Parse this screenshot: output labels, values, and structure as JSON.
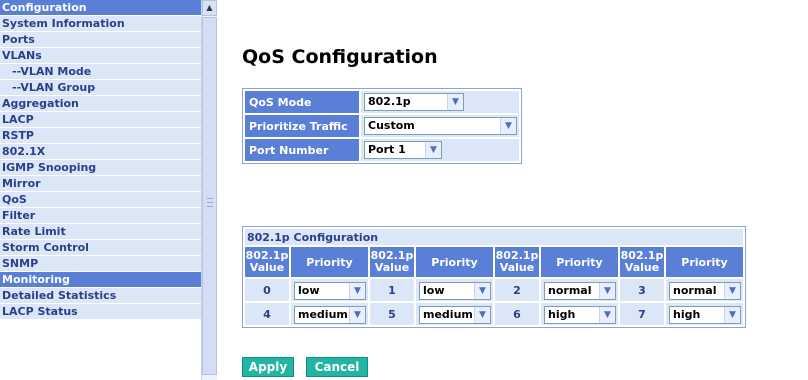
{
  "nav": {
    "items": [
      {
        "label": "Configuration",
        "kind": "header"
      },
      {
        "label": "System Information",
        "kind": "item"
      },
      {
        "label": "Ports",
        "kind": "item"
      },
      {
        "label": "VLANs",
        "kind": "item"
      },
      {
        "label": "--VLAN Mode",
        "kind": "sub"
      },
      {
        "label": "--VLAN Group",
        "kind": "sub"
      },
      {
        "label": "Aggregation",
        "kind": "item"
      },
      {
        "label": "LACP",
        "kind": "item"
      },
      {
        "label": "RSTP",
        "kind": "item"
      },
      {
        "label": "802.1X",
        "kind": "item"
      },
      {
        "label": "IGMP Snooping",
        "kind": "item"
      },
      {
        "label": "Mirror",
        "kind": "item"
      },
      {
        "label": "QoS",
        "kind": "item"
      },
      {
        "label": "Filter",
        "kind": "item"
      },
      {
        "label": "Rate Limit",
        "kind": "item"
      },
      {
        "label": "Storm Control",
        "kind": "item"
      },
      {
        "label": "SNMP",
        "kind": "item"
      },
      {
        "label": "Monitoring",
        "kind": "header"
      },
      {
        "label": "Detailed Statistics",
        "kind": "item"
      },
      {
        "label": "LACP Status",
        "kind": "item"
      }
    ]
  },
  "page": {
    "title": "QoS Configuration"
  },
  "qos": {
    "mode_label": "QoS Mode",
    "mode_value": "802.1p",
    "prioritize_label": "Prioritize Traffic",
    "prioritize_value": "Custom",
    "port_label": "Port Number",
    "port_value": "Port 1"
  },
  "p8021": {
    "title": "802.1p Configuration",
    "value_header": "802.1p Value",
    "priority_header": "Priority",
    "rows": [
      [
        {
          "value": "0",
          "priority": "low"
        },
        {
          "value": "1",
          "priority": "low"
        },
        {
          "value": "2",
          "priority": "normal"
        },
        {
          "value": "3",
          "priority": "normal"
        }
      ],
      [
        {
          "value": "4",
          "priority": "medium"
        },
        {
          "value": "5",
          "priority": "medium"
        },
        {
          "value": "6",
          "priority": "high"
        },
        {
          "value": "7",
          "priority": "high"
        }
      ]
    ]
  },
  "buttons": {
    "apply": "Apply",
    "cancel": "Cancel"
  },
  "icons": {
    "dropdown": "chevron-down-icon",
    "scroll_up": "scroll-up-arrow-icon"
  },
  "colors": {
    "header_blue": "#5a7fd6",
    "light_blue": "#dbe6f7",
    "nav_text": "#2c3f8a",
    "button_teal": "#22b5a4"
  }
}
